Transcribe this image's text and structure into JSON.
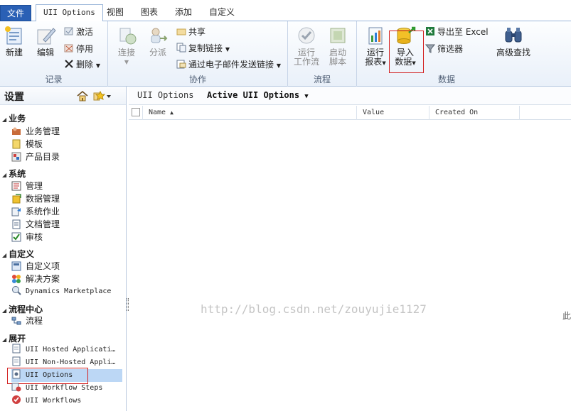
{
  "tabs": {
    "file": "文件",
    "active": "UII Options",
    "items": [
      "视图",
      "图表",
      "添加",
      "自定义"
    ]
  },
  "ribbon": {
    "record": {
      "label": "记录",
      "new": "新建",
      "edit": "编辑",
      "activate": "激活",
      "deactivate": "停用",
      "delete": "删除"
    },
    "collab": {
      "label": "协作",
      "connect": "连接",
      "assign": "分派",
      "share": "共享",
      "copy_link": "复制链接",
      "email_link": "通过电子邮件发送链接"
    },
    "process": {
      "label": "流程",
      "run_workflow": [
        "运行",
        "工作流"
      ],
      "start_script": [
        "启动",
        "脚本"
      ]
    },
    "data": {
      "label": "数据",
      "run_report": [
        "运行",
        "报表"
      ],
      "import_data": [
        "导入",
        "数据"
      ],
      "export_excel": "导出至 Excel",
      "filter": "筛选器",
      "advanced_find": "高级查找"
    }
  },
  "nav": {
    "title": "设置",
    "sections": [
      {
        "label": "业务",
        "items": [
          "业务管理",
          "模板",
          "产品目录"
        ]
      },
      {
        "label": "系统",
        "items": [
          "管理",
          "数据管理",
          "系统作业",
          "文档管理",
          "审核"
        ]
      },
      {
        "label": "自定义",
        "items": [
          "自定义项",
          "解决方案",
          "Dynamics Marketplace"
        ]
      },
      {
        "label": "流程中心",
        "items": [
          "流程"
        ]
      },
      {
        "label": "展开",
        "items": [
          "UII Hosted Applicati…",
          "UII Non-Hosted Appli…",
          "UII Options",
          "UII Workflow Steps",
          "UII Workflows"
        ]
      }
    ],
    "selected": "UII Options"
  },
  "main": {
    "entity": "UII Options",
    "view": "Active UII Options",
    "columns": [
      "Name",
      "Value",
      "Created On"
    ],
    "clipped_text": "此"
  },
  "watermark": "http://blog.csdn.net/zouyujie1127",
  "colors": {
    "file_tab": "#2a60b5",
    "selected_item": "#bcd7f5",
    "highlight_box": "#d32020"
  }
}
